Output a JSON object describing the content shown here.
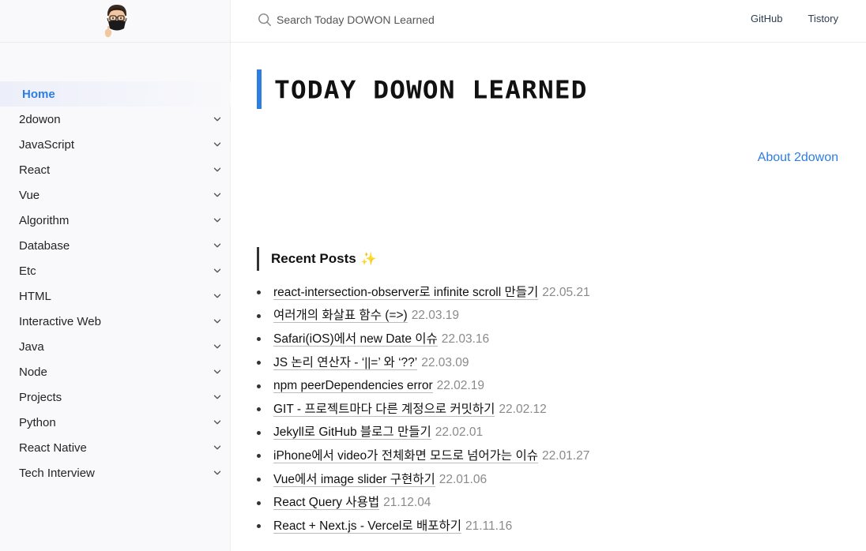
{
  "search": {
    "placeholder": "Search Today DOWON Learned"
  },
  "topnav": [
    {
      "label": "GitHub"
    },
    {
      "label": "Tistory"
    }
  ],
  "sidebar": {
    "items": [
      {
        "label": "Home",
        "active": true,
        "expandable": false
      },
      {
        "label": "2dowon",
        "expandable": true
      },
      {
        "label": "JavaScript",
        "expandable": true
      },
      {
        "label": "React",
        "expandable": true
      },
      {
        "label": "Vue",
        "expandable": true
      },
      {
        "label": "Algorithm",
        "expandable": true
      },
      {
        "label": "Database",
        "expandable": true
      },
      {
        "label": "Etc",
        "expandable": true
      },
      {
        "label": "HTML",
        "expandable": true
      },
      {
        "label": "Interactive Web",
        "expandable": true
      },
      {
        "label": "Java",
        "expandable": true
      },
      {
        "label": "Node",
        "expandable": true
      },
      {
        "label": "Projects",
        "expandable": true
      },
      {
        "label": "Python",
        "expandable": true
      },
      {
        "label": "React Native",
        "expandable": true
      },
      {
        "label": "Tech Interview",
        "expandable": true
      }
    ]
  },
  "main": {
    "title": "TODAY DOWON LEARNED",
    "about_link": "About 2dowon",
    "recent_heading": "Recent Posts",
    "recent_icon": "✨",
    "posts": [
      {
        "title": "react-intersection-observer로 infinite scroll 만들기",
        "date": "22.05.21"
      },
      {
        "title": "여러개의 화살표 함수 (=>)",
        "date": "22.03.19"
      },
      {
        "title": "Safari(iOS)에서 new Date 이슈",
        "date": "22.03.16"
      },
      {
        "title": "JS 논리 연산자 - ‘||=’ 와 ‘??’",
        "date": "22.03.09"
      },
      {
        "title": "npm peerDependencies error",
        "date": "22.02.19"
      },
      {
        "title": "GIT - 프로젝트마다 다른 계정으로 커밋하기",
        "date": "22.02.12"
      },
      {
        "title": "Jekyll로 GitHub 블로그 만들기",
        "date": "22.02.01"
      },
      {
        "title": "iPhone에서 video가 전체화면 모드로 넘어가는 이슈",
        "date": "22.01.27"
      },
      {
        "title": "Vue에서 image slider 구현하기",
        "date": "22.01.06"
      },
      {
        "title": "React Query 사용법",
        "date": "21.12.04"
      },
      {
        "title": "React + Next.js - Vercel로 배포하기",
        "date": "21.11.16"
      }
    ]
  },
  "colors": {
    "accent": "#2d7ee0",
    "sidebar_bg": "#f9f9fb",
    "date": "#8a8a8a"
  }
}
